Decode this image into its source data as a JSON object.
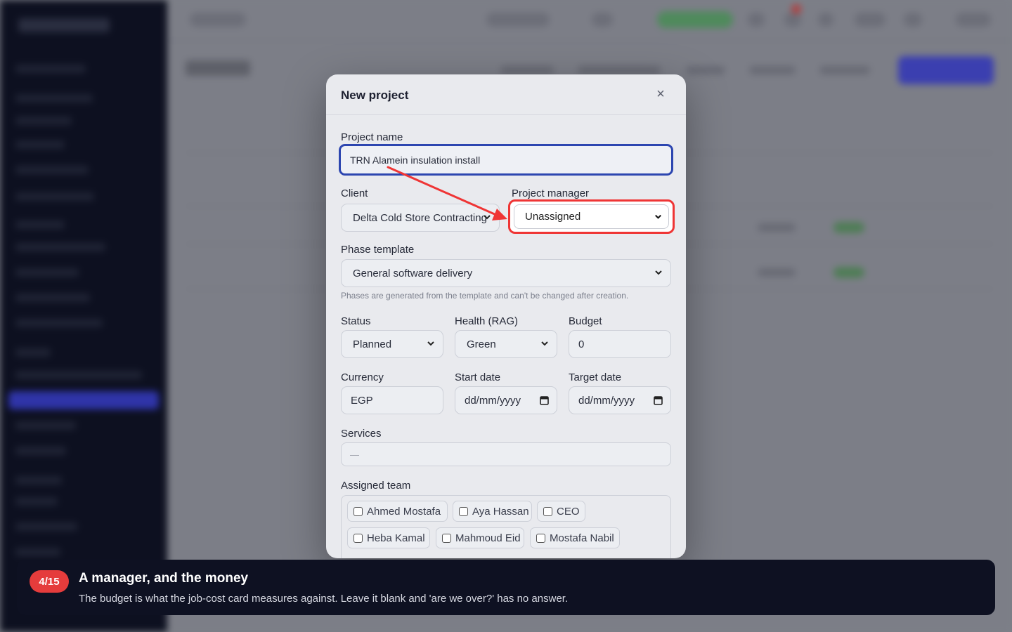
{
  "modal": {
    "title": "New project",
    "close_icon": "×",
    "project_name": {
      "label": "Project name",
      "value": "TRN Alamein insulation install"
    },
    "client": {
      "label": "Client",
      "value": "Delta Cold Store Contracting"
    },
    "project_manager": {
      "label": "Project manager",
      "value": "Unassigned"
    },
    "phase_template": {
      "label": "Phase template",
      "value": "General software delivery",
      "hint": "Phases are generated from the template and can't be changed after creation."
    },
    "status": {
      "label": "Status",
      "value": "Planned"
    },
    "health": {
      "label": "Health (RAG)",
      "value": "Green"
    },
    "budget": {
      "label": "Budget",
      "value": "0"
    },
    "currency": {
      "label": "Currency",
      "value": "EGP"
    },
    "start_date": {
      "label": "Start date",
      "value": "dd/mm/yyyy"
    },
    "target_date": {
      "label": "Target date",
      "value": "dd/mm/yyyy"
    },
    "services": {
      "label": "Services",
      "value": "—"
    },
    "assigned_team": {
      "label": "Assigned team",
      "members": [
        "Ahmed Mostafa",
        "Aya Hassan",
        "CEO",
        "Heba Kamal",
        "Mahmoud Eid",
        "Mostafa Nabil"
      ]
    }
  },
  "tour": {
    "step": "4/15",
    "title": "A manager, and the money",
    "body": "The budget is what the job-cost card measures against. Leave it blank and 'are we over?' has no answer."
  },
  "colors": {
    "accent": "#2d46b0",
    "highlight": "#ef3535",
    "tour_bg": "#0e1122"
  }
}
